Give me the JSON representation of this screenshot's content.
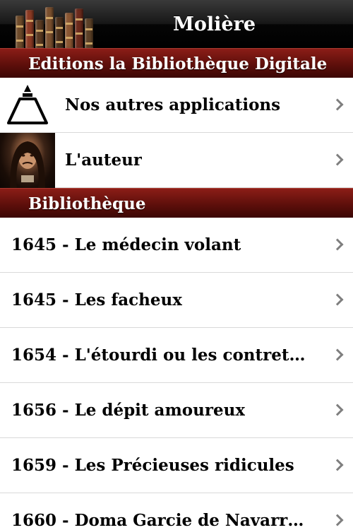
{
  "header": {
    "title": "Molière",
    "books": [
      {
        "color": "#6d4a2a",
        "height": 46
      },
      {
        "color": "#8c3b24",
        "height": 54
      },
      {
        "color": "#5a3a22",
        "height": 40
      },
      {
        "color": "#7a4f2e",
        "height": 58
      },
      {
        "color": "#4a2f1b",
        "height": 44
      },
      {
        "color": "#8a5632",
        "height": 50
      },
      {
        "color": "#6b2a1c",
        "height": 56
      },
      {
        "color": "#5c4027",
        "height": 42
      }
    ]
  },
  "sections": {
    "editions": {
      "title": "Editions la Bibliothèque Digitale",
      "items": [
        {
          "label": "Nos autres applications",
          "icon": "triangle-lamp-logo-icon"
        },
        {
          "label": "L'auteur",
          "icon": "author-portrait-icon"
        }
      ]
    },
    "library": {
      "title": "Bibliothèque",
      "items": [
        {
          "label": "1645 - Le médecin volant"
        },
        {
          "label": "1645 - Les facheux"
        },
        {
          "label": "1654 - L'étourdi ou les contrete..."
        },
        {
          "label": "1656 - Le dépit amoureux"
        },
        {
          "label": "1659 - Les Précieuses ridicules"
        },
        {
          "label": "1660 - Doma Garcie de Navarre..."
        }
      ]
    }
  },
  "colors": {
    "section_header": "#6b130e",
    "chevron": "#7f7f7f",
    "row_divider": "#d9d9d9"
  }
}
